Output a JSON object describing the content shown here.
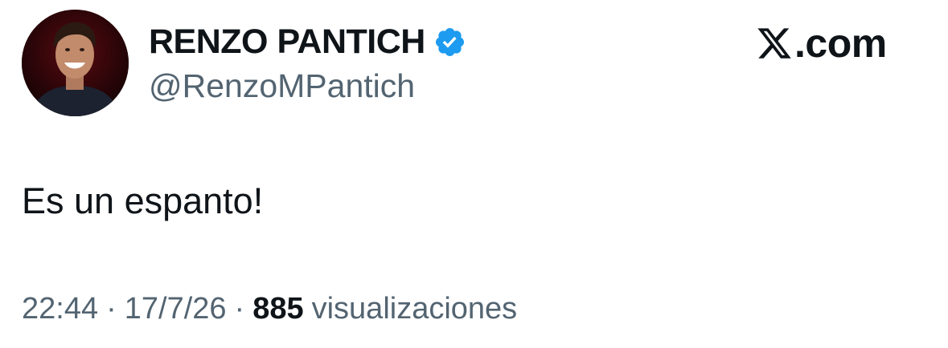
{
  "author": {
    "display_name": "RENZO PANTICH",
    "handle": "@RenzoMPantich",
    "verified": true,
    "verified_icon": "verified-badge-icon",
    "verified_color": "#1d9bf0",
    "avatar_icon": "profile-photo"
  },
  "brand": {
    "logo_icon": "x-logo-icon",
    "text": ".com"
  },
  "tweet": {
    "text": "Es un espanto!"
  },
  "meta": {
    "time": "22:44",
    "separator": "·",
    "date": "17/7/26",
    "views_count": "885",
    "views_label": "visualizaciones"
  },
  "colors": {
    "text_primary": "#0f1419",
    "text_secondary": "#536471",
    "background": "#ffffff"
  }
}
